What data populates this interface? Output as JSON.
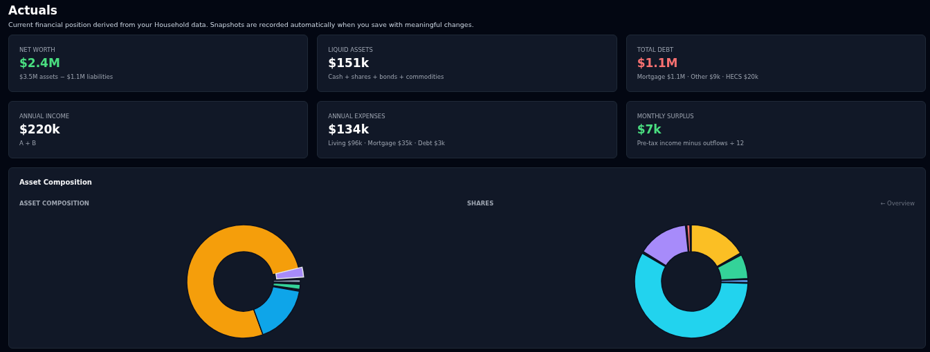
{
  "page": {
    "title": "Actuals",
    "subtitle": "Current financial position derived from your Household data. Snapshots are recorded automatically when you save with meaningful changes."
  },
  "cards": [
    {
      "label": "NET WORTH",
      "value": "$2.4M",
      "color": "#4ade80",
      "note": "$3.5M assets − $1.1M liabilities"
    },
    {
      "label": "LIQUID ASSETS",
      "value": "$151k",
      "color": "#ffffff",
      "note": "Cash + shares + bonds + commodities"
    },
    {
      "label": "TOTAL DEBT",
      "value": "$1.1M",
      "color": "#f87171",
      "note": "Mortgage $1.1M · Other $9k · HECS $20k"
    },
    {
      "label": "ANNUAL INCOME",
      "value": "$220k",
      "color": "#ffffff",
      "note": "A + B"
    },
    {
      "label": "ANNUAL EXPENSES",
      "value": "$134k",
      "color": "#ffffff",
      "note": "Living $96k · Mortgage $35k · Debt $3k"
    },
    {
      "label": "MONTHLY SURPLUS",
      "value": "$7k",
      "color": "#4ade80",
      "note": "Pre-tax income minus outflows ÷ 12"
    }
  ],
  "panel": {
    "title": "Asset Composition",
    "charts": [
      {
        "heading": "ASSET COMPOSITION",
        "kind": "allocation"
      },
      {
        "heading": "SHARES",
        "link": "← Overview",
        "kind": "shares"
      }
    ]
  }
}
